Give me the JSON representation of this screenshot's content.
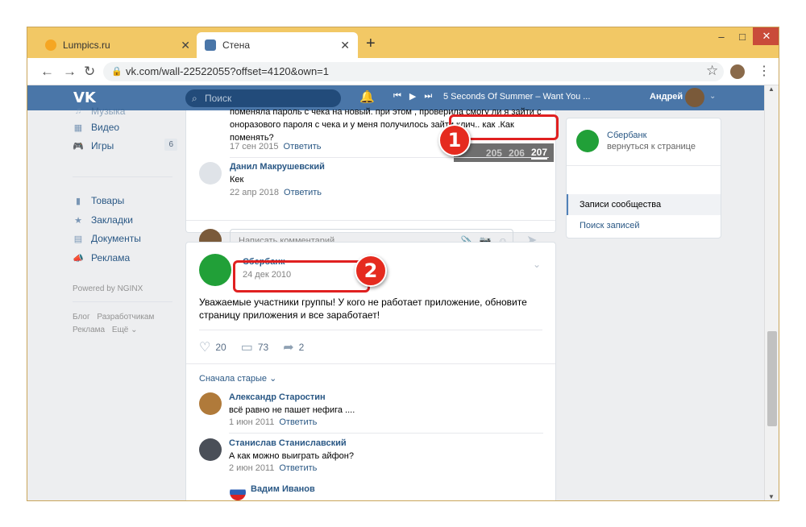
{
  "browser": {
    "tabs": [
      {
        "title": "Lumpics.ru",
        "icon": "lumpics-icon"
      },
      {
        "title": "Стена",
        "icon": "vk-icon"
      }
    ],
    "url": "vk.com/wall-22522055?offset=4120&own=1"
  },
  "vk_header": {
    "logo": "VK",
    "search_placeholder": "Поиск",
    "track": "5 Seconds Of Summer – Want You ...",
    "user": "Андрей"
  },
  "left_menu": {
    "items": [
      {
        "label": "Музыка",
        "icon": "music-icon"
      },
      {
        "label": "Видео",
        "icon": "video-icon"
      },
      {
        "label": "Игры",
        "icon": "games-icon",
        "count": "6"
      },
      {
        "label": "Товары",
        "icon": "bag-icon"
      },
      {
        "label": "Закладки",
        "icon": "star-icon"
      },
      {
        "label": "Документы",
        "icon": "document-icon"
      },
      {
        "label": "Реклама",
        "icon": "megaphone-icon"
      }
    ],
    "powered": "Powered by NGINX",
    "footer": [
      "Блог",
      "Разработчикам",
      "Реклама",
      "Ещё ⌄"
    ]
  },
  "post1": {
    "comment_text": "поменяла пароль с чека на новый. при этом , проверила смогу ли я зайти с оноразового пароля с чека и у меня получилось зайти.клич.. как .Как поменять?",
    "comment_date": "17 сен 2015",
    "reply_label": "Ответить",
    "pager": [
      "205",
      "206",
      "207"
    ],
    "comment2_author": "Данил Макрушевский",
    "comment2_text": "Кек",
    "comment2_date": "22 апр 2018",
    "comment_placeholder": "Написать комментарий..."
  },
  "post2": {
    "author": "Сбербанк",
    "date": "24 дек 2010",
    "text": "Уважаемые участники группы! У кого не работает приложение, обновите страницу приложения и все заработает!",
    "likes": "20",
    "comments": "73",
    "shares": "2",
    "sort_label": "Сначала старые ⌄",
    "comments_list": [
      {
        "author": "Александр Старостин",
        "text": "всё равно не пашет нефига ....",
        "date": "1 июн 2011"
      },
      {
        "author": "Станислав Станиславский",
        "text": "А как можно выиграть айфон?",
        "date": "2 июн 2011"
      },
      {
        "author": "Вадим Иванов"
      }
    ]
  },
  "right_column": {
    "title": "Сбербанк",
    "subtitle": "вернуться к странице",
    "items": [
      "Записи сообщества",
      "Поиск записей"
    ]
  },
  "annotations": {
    "badge1": "1",
    "badge2": "2"
  },
  "colors": {
    "vk_blue": "#4a76a8",
    "link": "#2a5885",
    "highlight": "#e02020"
  }
}
